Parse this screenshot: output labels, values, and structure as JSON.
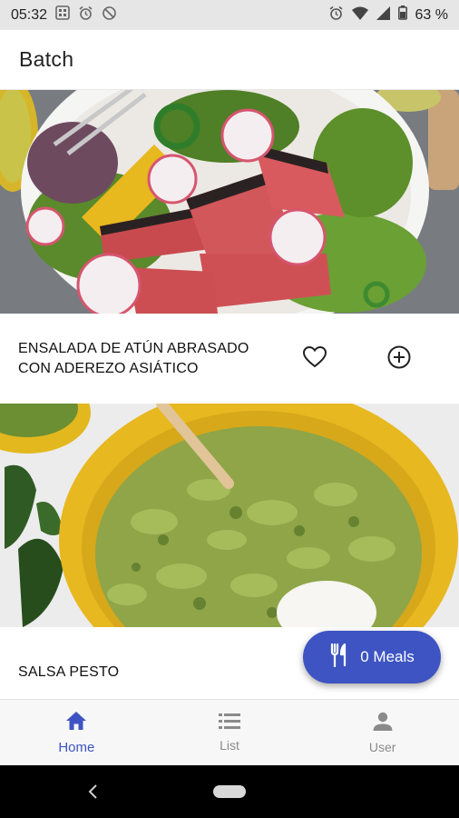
{
  "status_bar": {
    "time": "05:32",
    "battery": "63 %"
  },
  "app_bar": {
    "title": "Batch"
  },
  "recipes": [
    {
      "title": "ENSALADA DE ATÚN ABRASADO CON ADEREZO ASIÁTICO"
    },
    {
      "title": "SALSA PESTO"
    }
  ],
  "fab": {
    "label": "0 Meals"
  },
  "bottom_nav": {
    "items": [
      {
        "label": "Home",
        "icon": "home-icon",
        "active": true
      },
      {
        "label": "List",
        "icon": "list-icon",
        "active": false
      },
      {
        "label": "User",
        "icon": "user-icon",
        "active": false
      }
    ]
  },
  "colors": {
    "accent": "#3e54c2",
    "status_bar": "#e6e6e6",
    "nav_bar": "#000000"
  }
}
